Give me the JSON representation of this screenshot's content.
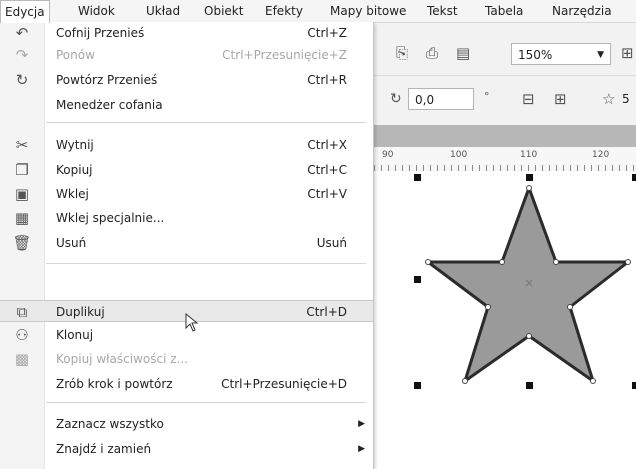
{
  "menubar": {
    "items": [
      "Edycja",
      "Widok",
      "Układ",
      "Obiekt",
      "Efekty",
      "Mapy bitowe",
      "Tekst",
      "Tabela",
      "Narzędzia"
    ]
  },
  "toolbar": {
    "zoom": "150%",
    "angle": "0,0",
    "degree": "°",
    "star_points": "5"
  },
  "ruler": {
    "ticks": [
      "90",
      "100",
      "110",
      "120"
    ]
  },
  "menu": {
    "items": [
      {
        "label": "Cofnij Przenieś",
        "shortcut": "Ctrl+Z",
        "icon": "undo-icon"
      },
      {
        "label": "Ponów",
        "shortcut": "Ctrl+Przesunięcie+Z",
        "icon": "redo-icon",
        "disabled": true
      },
      {
        "label": "Powtórz Przenieś",
        "shortcut": "Ctrl+R",
        "icon": "repeat-icon"
      },
      {
        "label": "Menedżer cofania",
        "shortcut": ""
      },
      {
        "label": "Wytnij",
        "shortcut": "Ctrl+X",
        "icon": "cut-icon"
      },
      {
        "label": "Kopiuj",
        "shortcut": "Ctrl+C",
        "icon": "copy-icon"
      },
      {
        "label": "Wklej",
        "shortcut": "Ctrl+V",
        "icon": "paste-icon"
      },
      {
        "label": "Wklej specjalnie...",
        "shortcut": "",
        "icon": "paste-special-icon"
      },
      {
        "label": "Usuń",
        "shortcut": "Usuń",
        "icon": "trash-icon"
      },
      {
        "label": "Duplikuj",
        "shortcut": "Ctrl+D",
        "icon": "duplicate-icon"
      },
      {
        "label": "Klonuj",
        "shortcut": "",
        "icon": "clone-icon"
      },
      {
        "label": "Kopiuj właściwości z...",
        "shortcut": "",
        "icon": "copy-properties-icon",
        "disabled": true
      },
      {
        "label": "Zrób krok i powtórz",
        "shortcut": "Ctrl+Przesunięcie+D"
      },
      {
        "label": "Zaznacz wszystko",
        "shortcut": "",
        "submenu": true
      },
      {
        "label": "Znajdź i zamień",
        "shortcut": "",
        "submenu": true
      }
    ]
  },
  "colors": {
    "star_fill": "#9a9a9a",
    "star_stroke": "#2b2b2b",
    "hover_bg": "#e9e9e9"
  }
}
